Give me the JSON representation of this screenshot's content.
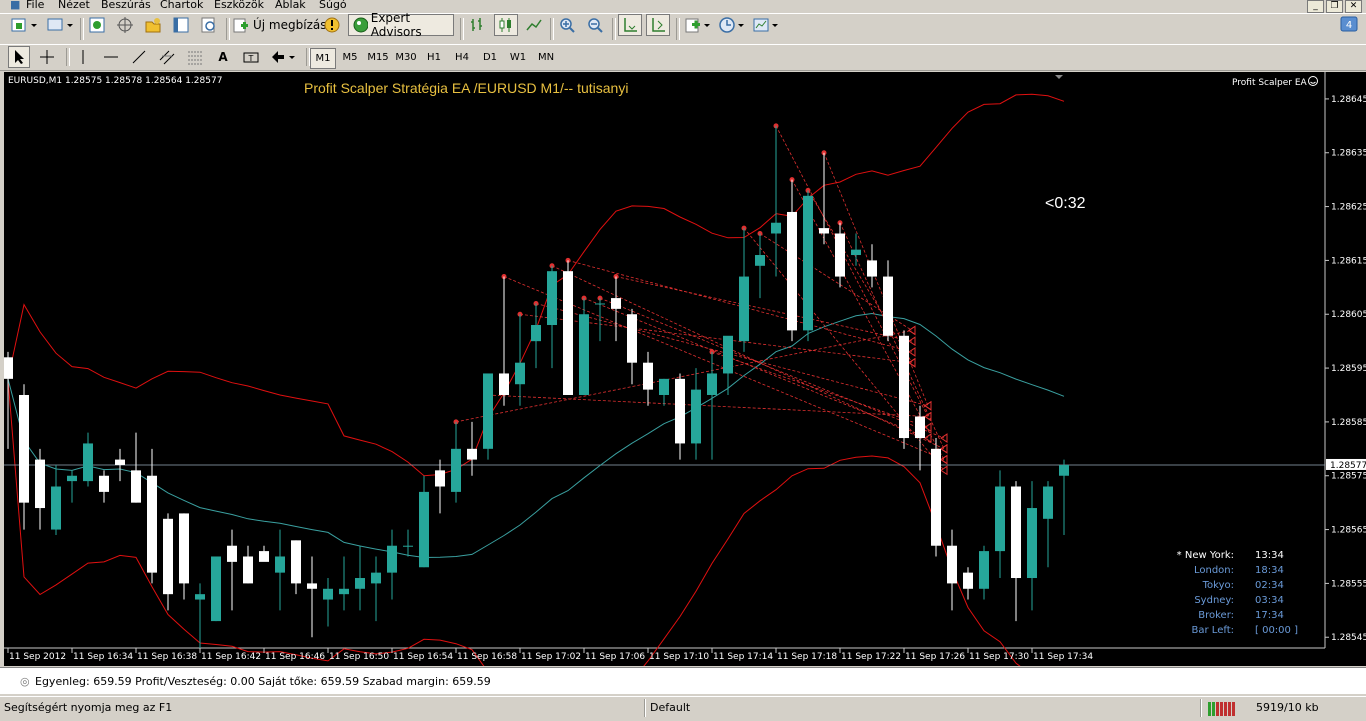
{
  "menu": [
    "File",
    "Nézet",
    "Beszúrás",
    "Chartok",
    "Eszközök",
    "Ablak",
    "Súgó"
  ],
  "toolbar": {
    "new_order": "Új megbízás",
    "expert_advisors": "Expert Advisors"
  },
  "timeframes": [
    "M1",
    "M5",
    "M15",
    "M30",
    "H1",
    "H4",
    "D1",
    "W1",
    "MN"
  ],
  "active_timeframe": "M1",
  "chart": {
    "symbol_header": "EURUSD,M1  1.28575 1.28578 1.28564 1.28577",
    "title": "Profit Scalper Stratégia EA /EURUSD M1/-- tutisanyi",
    "ea_label": "Profit Scalper  EA",
    "countdown": "<0:32",
    "current_price": "1.28577",
    "colors": {
      "bull": "#26a69a",
      "bear": "#ffffff",
      "band": "#e01010",
      "ma": "#3aa0a0",
      "arrow": "#e03030",
      "title": "#e8c040"
    }
  },
  "chart_data": {
    "type": "candlestick",
    "symbol": "EURUSD",
    "timeframe": "M1",
    "ylim": [
      1.28543,
      1.2865
    ],
    "y_ticks": [
      "1.28645",
      "1.28635",
      "1.28625",
      "1.28615",
      "1.28605",
      "1.28595",
      "1.28585",
      "1.28575",
      "1.28565",
      "1.28555",
      "1.28545"
    ],
    "x_ticks": [
      "11 Sep 2012",
      "11 Sep 16:34",
      "11 Sep 16:38",
      "11 Sep 16:42",
      "11 Sep 16:46",
      "11 Sep 16:50",
      "11 Sep 16:54",
      "11 Sep 16:58",
      "11 Sep 17:02",
      "11 Sep 17:06",
      "11 Sep 17:10",
      "11 Sep 17:14",
      "11 Sep 17:18",
      "11 Sep 17:22",
      "11 Sep 17:26",
      "11 Sep 17:30",
      "11 Sep 17:34"
    ],
    "candles": [
      [
        1.28597,
        1.28598,
        1.2858,
        1.28593
      ],
      [
        1.2859,
        1.28592,
        1.28565,
        1.2857
      ],
      [
        1.28578,
        1.2858,
        1.28565,
        1.28569
      ],
      [
        1.28565,
        1.28577,
        1.28564,
        1.28573
      ],
      [
        1.28574,
        1.28576,
        1.2857,
        1.28575
      ],
      [
        1.28574,
        1.28583,
        1.28573,
        1.28581
      ],
      [
        1.28575,
        1.28576,
        1.2857,
        1.28572
      ],
      [
        1.28578,
        1.2858,
        1.28574,
        1.28577
      ],
      [
        1.28576,
        1.28583,
        1.2857,
        1.2857
      ],
      [
        1.28575,
        1.2858,
        1.28555,
        1.28557
      ],
      [
        1.28567,
        1.28568,
        1.2855,
        1.28553
      ],
      [
        1.28568,
        1.28568,
        1.28552,
        1.28555
      ],
      [
        1.28552,
        1.28555,
        1.28543,
        1.28553
      ],
      [
        1.28548,
        1.28558,
        1.28548,
        1.2856
      ],
      [
        1.28562,
        1.28565,
        1.2855,
        1.28559
      ],
      [
        1.2856,
        1.28562,
        1.28555,
        1.28555
      ],
      [
        1.28561,
        1.28562,
        1.2856,
        1.28559
      ],
      [
        1.28557,
        1.28565,
        1.2855,
        1.2856
      ],
      [
        1.28563,
        1.28563,
        1.28553,
        1.28555
      ],
      [
        1.28555,
        1.2856,
        1.28545,
        1.28554
      ],
      [
        1.28552,
        1.28556,
        1.28547,
        1.28554
      ],
      [
        1.28553,
        1.2856,
        1.2855,
        1.28554
      ],
      [
        1.28554,
        1.28562,
        1.2855,
        1.28556
      ],
      [
        1.28555,
        1.2856,
        1.28548,
        1.28557
      ],
      [
        1.28557,
        1.28565,
        1.28552,
        1.28562
      ],
      [
        1.28562,
        1.28565,
        1.2856,
        1.28562
      ],
      [
        1.28558,
        1.28575,
        1.28558,
        1.28572
      ],
      [
        1.28576,
        1.28578,
        1.28568,
        1.28573
      ],
      [
        1.28572,
        1.28585,
        1.2857,
        1.2858
      ],
      [
        1.2858,
        1.28585,
        1.28575,
        1.28578
      ],
      [
        1.2858,
        1.2859,
        1.28578,
        1.28594
      ],
      [
        1.28594,
        1.28612,
        1.28588,
        1.2859
      ],
      [
        1.28592,
        1.28605,
        1.28588,
        1.28596
      ],
      [
        1.286,
        1.28607,
        1.28595,
        1.28603
      ],
      [
        1.28603,
        1.28614,
        1.28595,
        1.28613
      ],
      [
        1.28613,
        1.28615,
        1.2859,
        1.2859
      ],
      [
        1.2859,
        1.28608,
        1.2859,
        1.28605
      ],
      [
        1.28607,
        1.28608,
        1.286,
        1.28607
      ],
      [
        1.28608,
        1.28612,
        1.286,
        1.28606
      ],
      [
        1.28605,
        1.28606,
        1.28592,
        1.28596
      ],
      [
        1.28596,
        1.28598,
        1.28588,
        1.28591
      ],
      [
        1.2859,
        1.28593,
        1.28588,
        1.28593
      ],
      [
        1.28593,
        1.28594,
        1.28578,
        1.28581
      ],
      [
        1.28581,
        1.28595,
        1.28578,
        1.28591
      ],
      [
        1.2859,
        1.28598,
        1.28578,
        1.28594
      ],
      [
        1.28594,
        1.286,
        1.2859,
        1.28601
      ],
      [
        1.286,
        1.28621,
        1.28598,
        1.28612
      ],
      [
        1.28614,
        1.2862,
        1.28608,
        1.28616
      ],
      [
        1.2862,
        1.2864,
        1.28612,
        1.28622
      ],
      [
        1.28624,
        1.2863,
        1.286,
        1.28602
      ],
      [
        1.28602,
        1.28628,
        1.286,
        1.28627
      ],
      [
        1.28621,
        1.28635,
        1.28618,
        1.2862
      ],
      [
        1.2862,
        1.28622,
        1.2861,
        1.28612
      ],
      [
        1.28616,
        1.2862,
        1.28614,
        1.28617
      ],
      [
        1.28615,
        1.28618,
        1.2861,
        1.28612
      ],
      [
        1.28612,
        1.28615,
        1.286,
        1.28601
      ],
      [
        1.28601,
        1.28602,
        1.2858,
        1.28582
      ],
      [
        1.28586,
        1.28588,
        1.28576,
        1.28582
      ],
      [
        1.2858,
        1.28582,
        1.2856,
        1.28562
      ],
      [
        1.28562,
        1.28565,
        1.2855,
        1.28555
      ],
      [
        1.28557,
        1.28558,
        1.28552,
        1.28554
      ],
      [
        1.28554,
        1.28562,
        1.28552,
        1.28561
      ],
      [
        1.28561,
        1.28576,
        1.28556,
        1.28573
      ],
      [
        1.28573,
        1.28574,
        1.28548,
        1.28556
      ],
      [
        1.28556,
        1.28574,
        1.2855,
        1.28569
      ],
      [
        1.28567,
        1.28574,
        1.28558,
        1.28573
      ],
      [
        1.28575,
        1.28578,
        1.28564,
        1.28577
      ]
    ]
  },
  "world_clock": [
    {
      "city": "* New York:",
      "time": "13:34"
    },
    {
      "city": "London:",
      "time": "18:34"
    },
    {
      "city": "Tokyo:",
      "time": "02:34"
    },
    {
      "city": "Sydney:",
      "time": "03:34"
    },
    {
      "city": "Broker:",
      "time": "17:34"
    },
    {
      "city": "Bar Left:",
      "time": "[ 00:00 ]"
    }
  ],
  "account_text": "Egyenleg: 659.59  Profit/Veszteség: 0.00  Saját tőke: 659.59  Szabad margin: 659.59",
  "status": {
    "help": "Segítségért nyomja meg az F1",
    "profile": "Default",
    "traffic": "5919/10 kb"
  }
}
